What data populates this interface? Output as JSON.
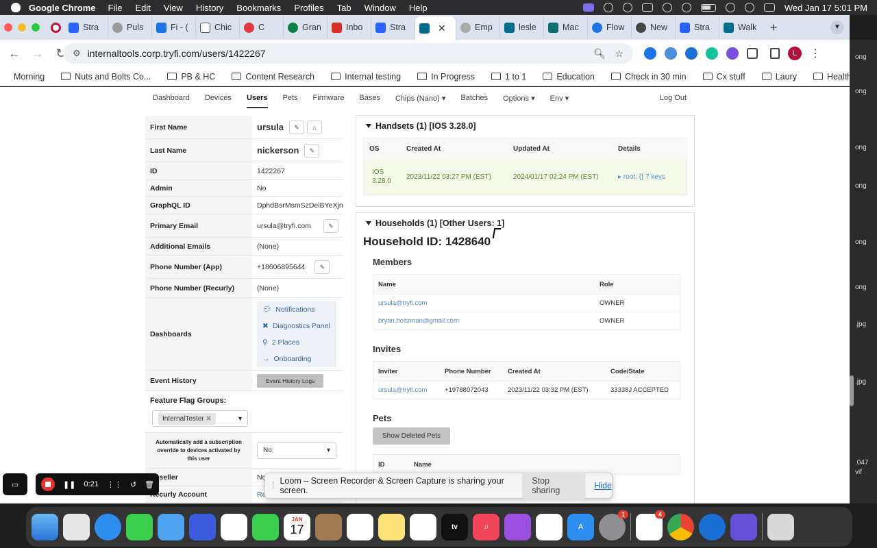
{
  "menubar": {
    "app": "Google Chrome",
    "items": [
      "File",
      "Edit",
      "View",
      "History",
      "Bookmarks",
      "Profiles",
      "Tab",
      "Window",
      "Help"
    ],
    "datetime": "Wed Jan 17  5:01 PM"
  },
  "tabs": [
    {
      "label": "Stra",
      "color": "#2962ff"
    },
    {
      "label": "Puls",
      "color": "#888888"
    },
    {
      "label": "Fi - (",
      "color": "#1a73e8"
    },
    {
      "label": "Chic",
      "color": "#555555"
    },
    {
      "label": "C",
      "color": "#e03a3e"
    },
    {
      "label": "Gran",
      "color": "#0b8043"
    },
    {
      "label": "Inbo",
      "color": "#d93025"
    },
    {
      "label": "Stra",
      "color": "#2962ff"
    },
    {
      "label": "",
      "color": "#006d8f",
      "active": true
    },
    {
      "label": "Emp",
      "color": "#888888"
    },
    {
      "label": "lesle",
      "color": "#006d8f"
    },
    {
      "label": "Mac",
      "color": "#0a6e6e"
    },
    {
      "label": "Flow",
      "color": "#1a73e8"
    },
    {
      "label": "New",
      "color": "#444444"
    },
    {
      "label": "Stra",
      "color": "#2962ff"
    },
    {
      "label": "Walk",
      "color": "#006d8f"
    }
  ],
  "toolbar": {
    "url": "internaltools.corp.tryfi.com/users/1422267",
    "avatar": "L"
  },
  "bookmarks": [
    "Morning",
    "Nuts and Bolts Co...",
    "PB & HC",
    "Content Research",
    "Internal testing",
    "In Progress",
    "1 to 1",
    "Education",
    "Check in 30 min",
    "Cx stuff",
    "Laury",
    "Health"
  ],
  "nav": {
    "items": [
      "Dashboard",
      "Devices",
      "Users",
      "Pets",
      "Firmware",
      "Bases",
      "Chips (Nano)",
      "Batches",
      "Options",
      "Env"
    ],
    "active": "Users",
    "logout": "Log Out"
  },
  "profile": {
    "first_name_label": "First Name",
    "first_name": "ursula",
    "last_name_label": "Last Name",
    "last_name": "nickerson",
    "id_label": "ID",
    "id": "1422267",
    "admin_label": "Admin",
    "admin": "No",
    "graphql_label": "GraphQL ID",
    "graphql": "DphdBsrMsmSzDeiBYeXjn",
    "email_label": "Primary Email",
    "email": "ursula@tryfi.com",
    "add_emails_label": "Additional Emails",
    "add_emails": "(None)",
    "phone_app_label": "Phone Number (App)",
    "phone_app": "+18606895644",
    "phone_recurly_label": "Phone Number (Recurly)",
    "phone_recurly": "(None)",
    "dashboards_label": "Dashboards",
    "dashboards": [
      "Notifications",
      "Diagnostics Panel",
      "2 Places",
      "Onboarding"
    ],
    "event_history_label": "Event History",
    "event_history_btn": "Event History Logs",
    "ffg_label": "Feature Flag Groups:",
    "ffg_chip": "InternalTester",
    "auto_sub_label": "Automatically add a subscription override to devices activated by this user",
    "auto_sub_value": "No",
    "reseller_label": "Reseller",
    "reseller_value": "No",
    "recurly_label": "Recurly Account",
    "recurly_value": "Re"
  },
  "handsets": {
    "title": "Handsets (1) [IOS 3.28.0]",
    "headers": [
      "OS",
      "Created At",
      "Updated At",
      "Details"
    ],
    "row": {
      "os": "IOS 3.28.0",
      "created": "2023/11/22 03:27 PM (EST)",
      "updated": "2024/01/17 02:24 PM (EST)",
      "details": "▸ root:  {} 7 keys"
    }
  },
  "households": {
    "title": "Households (1) [Other Users: 1]",
    "household_id": "Household ID: 1428640",
    "members_title": "Members",
    "members_headers": [
      "Name",
      "Role"
    ],
    "members": [
      {
        "name": "ursula@tryfi.com",
        "role": "OWNER"
      },
      {
        "name": "bryan.holtzman@gmail.com",
        "role": "OWNER"
      }
    ],
    "invites_title": "Invites",
    "invites_headers": [
      "Inviter",
      "Phone Number",
      "Created At",
      "Code/State"
    ],
    "invite": {
      "inviter": "ursula@tryfi.com",
      "phone": "+19788072043",
      "created": "2023/11/22 03:32 PM (EST)",
      "code": "33338J ACCEPTED"
    },
    "pets_title": "Pets",
    "show_deleted": "Show Deleted Pets",
    "pets_headers": [
      "ID",
      "Name"
    ]
  },
  "loom": {
    "message": "Loom – Screen Recorder & Screen Capture is sharing your screen.",
    "stop": "Stop sharing",
    "hide": "Hide",
    "timer": "0:21"
  },
  "dock": {
    "calendar_month": "JAN",
    "calendar_day": "17",
    "badge_settings": "1",
    "badge_slack": "4"
  },
  "right_snippets": [
    "ong",
    "ong",
    "ong",
    "ong",
    "ong",
    ".jpg",
    "ong",
    ".jpg",
    ".047",
    "vif"
  ]
}
